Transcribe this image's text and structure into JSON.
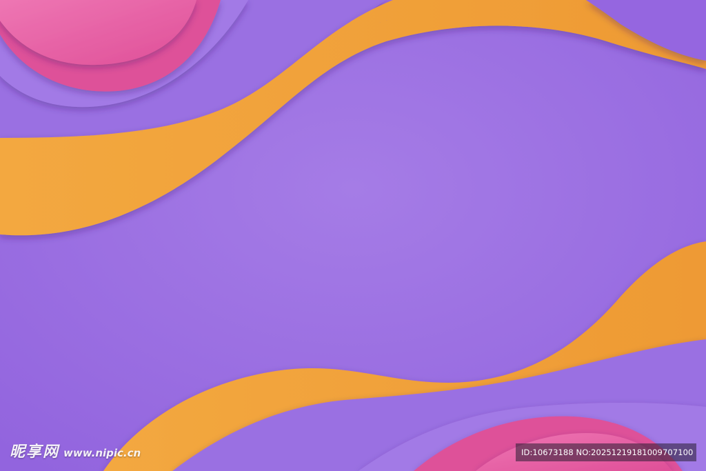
{
  "background": {
    "colors": {
      "purple_base": "#9a6ee0",
      "purple_light": "#a77fe6",
      "purple_band": "#9b72e3",
      "orange": "#f0a03c",
      "orange_light": "#f4b04e",
      "pink": "#e5579f",
      "pink_light": "#ee75b2"
    }
  },
  "watermark": {
    "logo": "昵享网",
    "url": "www.nipic.cn",
    "id_info": "ID:10673188 NO:20251219181009707100"
  }
}
